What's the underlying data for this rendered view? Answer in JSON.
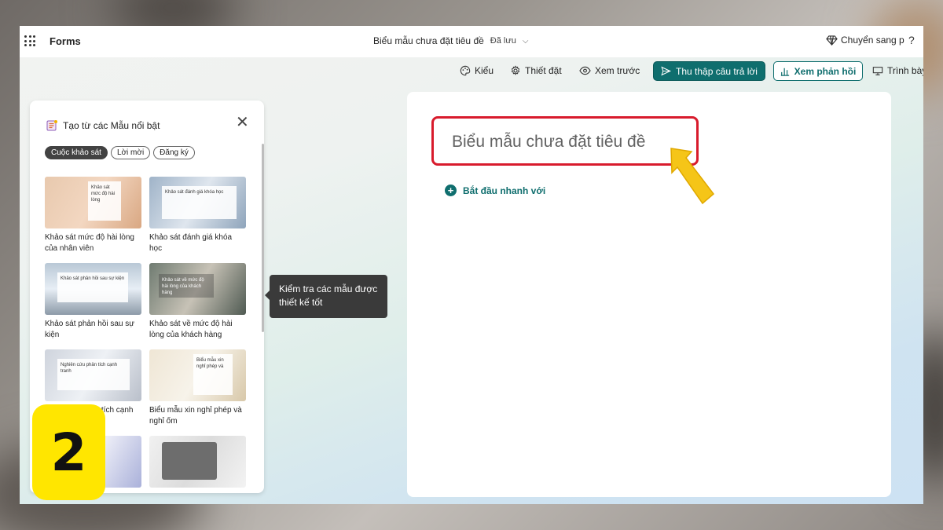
{
  "app": {
    "name": "Forms"
  },
  "document": {
    "title": "Biểu mẫu chưa đặt tiêu đề",
    "status": "Đã lưu"
  },
  "header": {
    "premium_label": "Chuyển sang p",
    "help_label": "?"
  },
  "toolbar": {
    "style_label": "Kiểu",
    "settings_label": "Thiết đặt",
    "preview_label": "Xem trước",
    "collect_label": "Thu thập câu trả lời",
    "responses_label": "Xem phản hồi",
    "present_label": "Trình bày"
  },
  "template_panel": {
    "title": "Tạo từ các Mẫu nổi bật",
    "chips": [
      "Cuộc khảo sát",
      "Lời mời",
      "Đăng ký"
    ],
    "templates": [
      {
        "label": "Khảo sát mức độ hài lòng của nhân viên",
        "card": "Khảo sát mức độ hài lòng"
      },
      {
        "label": "Khảo sát đánh giá khóa học",
        "card": "Khảo sát đánh giá khóa học"
      },
      {
        "label": "Khảo sát phản hồi sau sự kiện",
        "card": "Khảo sát phản hồi sau sự kiện"
      },
      {
        "label": "Khảo sát về mức độ hài lòng của khách hàng",
        "card": "Khảo sát về mức độ hài lòng của khách hàng"
      },
      {
        "label": "ân tích cạnh",
        "card": "Nghiên cứu phân tích cạnh tranh"
      },
      {
        "label": "Biểu mẫu xin nghỉ phép và nghỉ ốm",
        "card": "Biểu mẫu xin nghỉ phép và"
      }
    ]
  },
  "tooltip": {
    "text": "Kiểm tra các mẫu được thiết kế tốt"
  },
  "form": {
    "title_placeholder": "Biểu mẫu chưa đặt tiêu đề",
    "quickstart_label": "Bắt đầu nhanh với"
  },
  "annotation": {
    "step_number": "2"
  },
  "colors": {
    "accent": "#0f6e6e",
    "highlight_border": "#d81b2c",
    "step_badge": "#ffe600",
    "arrow": "#f5c518"
  }
}
